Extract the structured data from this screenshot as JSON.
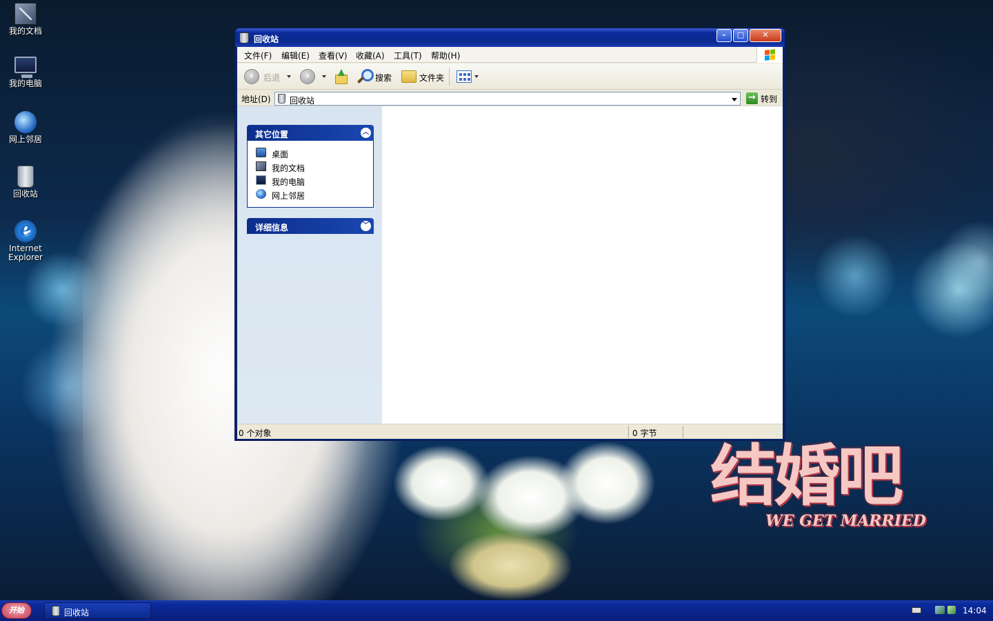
{
  "desktop": {
    "icons": [
      {
        "label": "我的文档",
        "icon": "my-documents-icon"
      },
      {
        "label": "我的电脑",
        "icon": "my-computer-icon"
      },
      {
        "label": "网上邻居",
        "icon": "network-places-icon"
      },
      {
        "label": "回收站",
        "icon": "recycle-bin-icon"
      },
      {
        "label_line1": "Internet",
        "label_line2": "Explorer",
        "icon": "internet-explorer-icon"
      }
    ],
    "wallpaper": {
      "title": "结婚吧",
      "subtitle": "WE GET MARRIED"
    }
  },
  "window": {
    "title": "回收站",
    "controls": {
      "minimize": "–",
      "maximize": "□",
      "close": "✕"
    },
    "menu": [
      "文件(F)",
      "编辑(E)",
      "查看(V)",
      "收藏(A)",
      "工具(T)",
      "帮助(H)"
    ],
    "toolbar": {
      "back_label": "后退",
      "search_label": "搜索",
      "folders_label": "文件夹"
    },
    "address": {
      "label": "地址(D)",
      "value": "回收站",
      "go_label": "转到"
    },
    "taskpane": {
      "other_places": {
        "title": "其它位置",
        "items": [
          {
            "label": "桌面",
            "icon": "desktop-icon"
          },
          {
            "label": "我的文档",
            "icon": "my-documents-icon"
          },
          {
            "label": "我的电脑",
            "icon": "my-computer-icon"
          },
          {
            "label": "网上邻居",
            "icon": "network-places-icon"
          }
        ]
      },
      "details": {
        "title": "详细信息"
      }
    },
    "status": {
      "objects": "0 个对象",
      "size": "0 字节"
    }
  },
  "taskbar": {
    "start_label": "开始",
    "tasks": [
      {
        "label": "回收站"
      }
    ],
    "clock": "14:04"
  }
}
